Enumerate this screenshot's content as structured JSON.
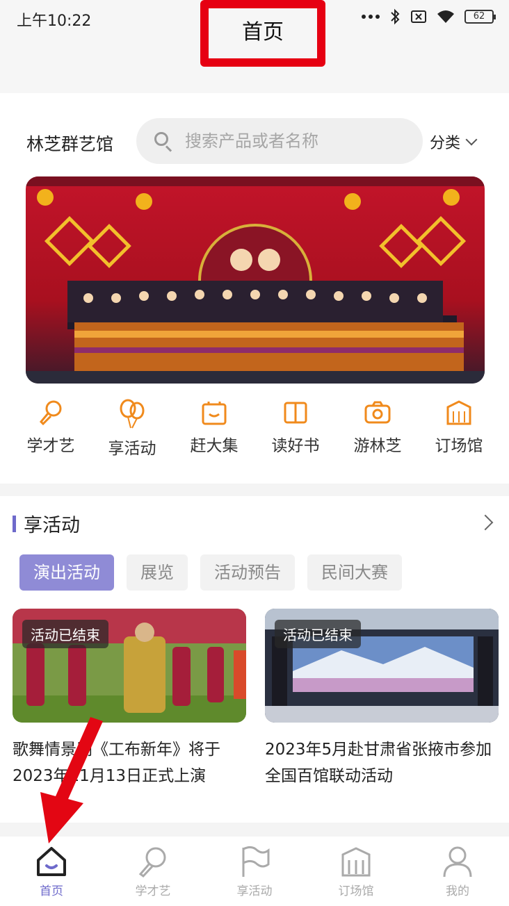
{
  "status_bar": {
    "time": "上午10:22",
    "battery": "62"
  },
  "header": {
    "title": "首页"
  },
  "top": {
    "venue_name": "林芝群艺馆",
    "search_placeholder": "搜索产品或者名称",
    "category_label": "分类"
  },
  "quick_nav": [
    {
      "label": "学才艺",
      "icon": "microphone-icon"
    },
    {
      "label": "享活动",
      "icon": "balloons-icon"
    },
    {
      "label": "赶大集",
      "icon": "bag-icon"
    },
    {
      "label": "读好书",
      "icon": "book-icon"
    },
    {
      "label": "游林芝",
      "icon": "camera-icon"
    },
    {
      "label": "订场馆",
      "icon": "building-icon"
    }
  ],
  "section": {
    "title": "享活动",
    "tabs": [
      "演出活动",
      "展览",
      "活动预告",
      "民间大赛"
    ],
    "active_tab": "演出活动",
    "cards": [
      {
        "badge": "活动已结束",
        "title": "歌舞情景剧《工布新年》将于2023年11月13日正式上演"
      },
      {
        "badge": "活动已结束",
        "title": "2023年5月赴甘肃省张掖市参加全国百馆联动活动"
      }
    ]
  },
  "tabbar": [
    {
      "label": "首页",
      "icon": "home-icon",
      "active": true
    },
    {
      "label": "学才艺",
      "icon": "microphone-icon",
      "active": false
    },
    {
      "label": "享活动",
      "icon": "flag-icon",
      "active": false
    },
    {
      "label": "订场馆",
      "icon": "building-icon",
      "active": false
    },
    {
      "label": "我的",
      "icon": "user-icon",
      "active": false
    }
  ],
  "colors": {
    "accent": "#6e6acb",
    "orange": "#f08a1c",
    "highlight_red": "#e60012"
  }
}
